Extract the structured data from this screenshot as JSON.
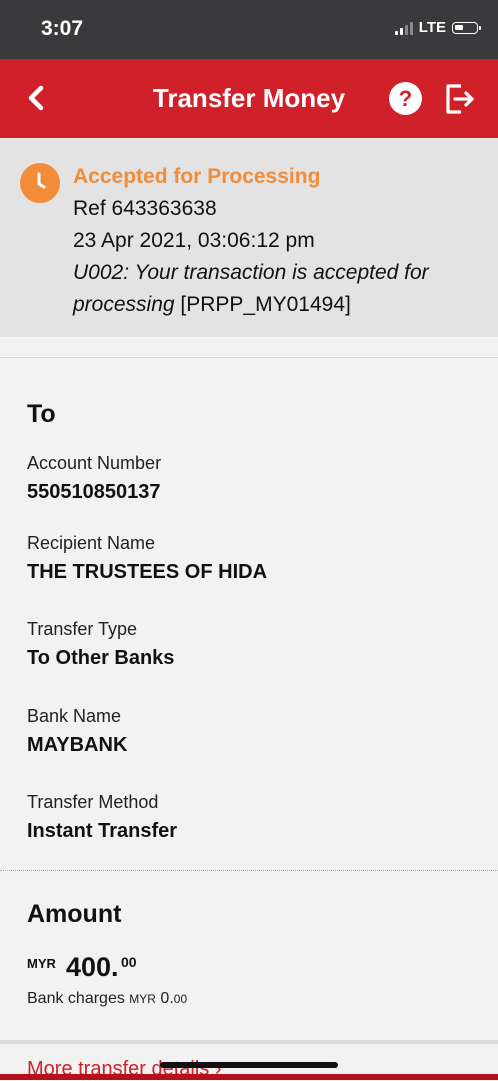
{
  "status_bar": {
    "time": "3:07",
    "network": "LTE"
  },
  "header": {
    "title": "Transfer Money",
    "help_label": "?"
  },
  "banner": {
    "status": "Accepted for Processing",
    "ref": "Ref 643363638",
    "datetime": "23 Apr 2021, 03:06:12 pm",
    "note_italic_1": "U002: Your transaction is accepted for",
    "note_italic_2": "processing",
    "note_code": "[PRPP_MY01494]",
    "accent_color": "#f28c38"
  },
  "to_section": {
    "heading": "To",
    "fields": [
      {
        "label": "Account Number",
        "value": "550510850137"
      },
      {
        "label": "Recipient Name",
        "value": "THE TRUSTEES OF HIDA"
      },
      {
        "label": "Transfer Type",
        "value": "To Other Banks"
      },
      {
        "label": "Bank Name",
        "value": "MAYBANK"
      },
      {
        "label": "Transfer Method",
        "value": "Instant Transfer"
      }
    ]
  },
  "amount_section": {
    "heading": "Amount",
    "currency": "MYR",
    "amount_whole": "400.",
    "amount_cents": "00",
    "bank_charges_label": "Bank charges",
    "bank_charges_currency": "MYR",
    "bank_charges_whole": "0.",
    "bank_charges_cents": "00"
  },
  "footer": {
    "more_link": "More transfer details"
  },
  "colors": {
    "brand_red": "#d0202a",
    "status_orange": "#f28c38"
  },
  "icons": {
    "back": "chevron-left-icon",
    "help": "help-icon",
    "logout": "logout-icon",
    "status": "clock-icon"
  }
}
